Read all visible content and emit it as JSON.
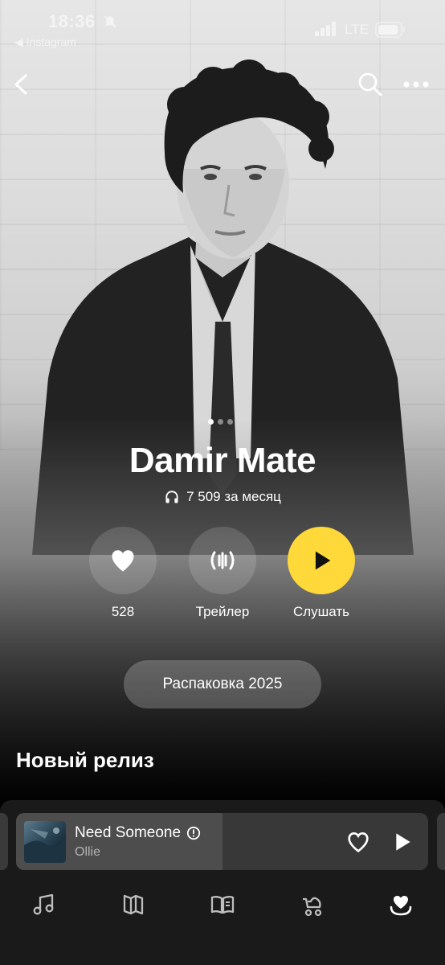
{
  "status_bar": {
    "time": "18:36",
    "back_to_app": "◀ Instagram",
    "network": "LTE"
  },
  "nav": {
    "back_icon": "chevron-left-icon",
    "search_icon": "search-icon",
    "more_icon": "more-dots-icon"
  },
  "hero": {
    "pager_dots": 3,
    "pager_active_index": 0
  },
  "artist": {
    "name": "Damir Mate",
    "monthly_listeners": "7 509 за месяц"
  },
  "actions": {
    "likes_label": "528",
    "trailer_label": "Трейлер",
    "listen_label": "Слушать"
  },
  "unpack_button": "Распаковка 2025",
  "new_release": {
    "title": "Новый релиз"
  },
  "mini_player": {
    "track_title": "Need Someone",
    "artist": "Ollie",
    "progress": 0.5
  },
  "tabs": [
    {
      "icon": "music-note-icon"
    },
    {
      "icon": "map-icon"
    },
    {
      "icon": "book-icon"
    },
    {
      "icon": "stroller-icon"
    },
    {
      "icon": "heart-collection-icon",
      "active": true
    }
  ],
  "colors": {
    "accent": "#ffd83a",
    "sheet_bg": "#1a1a1a",
    "mini_player_bg": "#383838"
  }
}
